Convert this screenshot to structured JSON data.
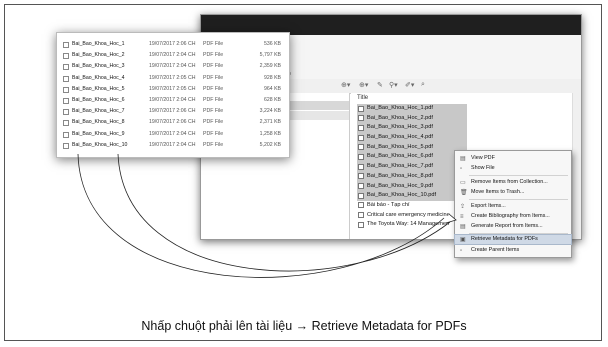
{
  "zotero": {
    "toolbar_hint": "ip",
    "column_title": "Title",
    "items": [
      {
        "title": "Bai_Bao_Khoa_Hoc_1.pdf",
        "selected": true
      },
      {
        "title": "Bai_Bao_Khoa_Hoc_2.pdf",
        "selected": true
      },
      {
        "title": "Bai_Bao_Khoa_Hoc_3.pdf",
        "selected": true
      },
      {
        "title": "Bai_Bao_Khoa_Hoc_4.pdf",
        "selected": true
      },
      {
        "title": "Bai_Bao_Khoa_Hoc_5.pdf",
        "selected": true
      },
      {
        "title": "Bai_Bao_Khoa_Hoc_6.pdf",
        "selected": true
      },
      {
        "title": "Bai_Bao_Khoa_Hoc_7.pdf",
        "selected": true
      },
      {
        "title": "Bai_Bao_Khoa_Hoc_8.pdf",
        "selected": true
      },
      {
        "title": "Bai_Bao_Khoa_Hoc_9.pdf",
        "selected": true
      },
      {
        "title": "Bai_Bao_Khoa_Hoc_10.pdf",
        "selected": true
      },
      {
        "title": "Bài báo - Tạp chí",
        "selected": false
      },
      {
        "title": "Critical care emergency medicine",
        "selected": false
      },
      {
        "title": "The Toyota Way: 14 Managemen",
        "selected": false
      }
    ]
  },
  "explorer": {
    "files": [
      {
        "name": "Bai_Bao_Khoa_Hoc_1",
        "date": "19/07/2017 2:06 CH",
        "type": "PDF File",
        "size": "536 KB"
      },
      {
        "name": "Bai_Bao_Khoa_Hoc_2",
        "date": "19/07/2017 2:04 CH",
        "type": "PDF File",
        "size": "5,797 KB"
      },
      {
        "name": "Bai_Bao_Khoa_Hoc_3",
        "date": "19/07/2017 2:04 CH",
        "type": "PDF File",
        "size": "2,359 KB"
      },
      {
        "name": "Bai_Bao_Khoa_Hoc_4",
        "date": "19/07/2017 2:05 CH",
        "type": "PDF File",
        "size": "928 KB"
      },
      {
        "name": "Bai_Bao_Khoa_Hoc_5",
        "date": "19/07/2017 2:05 CH",
        "type": "PDF File",
        "size": "964 KB"
      },
      {
        "name": "Bai_Bao_Khoa_Hoc_6",
        "date": "19/07/2017 2:04 CH",
        "type": "PDF File",
        "size": "628 KB"
      },
      {
        "name": "Bai_Bao_Khoa_Hoc_7",
        "date": "19/07/2017 2:06 CH",
        "type": "PDF File",
        "size": "3,224 KB"
      },
      {
        "name": "Bai_Bao_Khoa_Hoc_8",
        "date": "19/07/2017 2:06 CH",
        "type": "PDF File",
        "size": "2,371 KB"
      },
      {
        "name": "Bai_Bao_Khoa_Hoc_9",
        "date": "19/07/2017 2:04 CH",
        "type": "PDF File",
        "size": "1,258 KB"
      },
      {
        "name": "Bai_Bao_Khoa_Hoc_10",
        "date": "19/07/2017 2:04 CH",
        "type": "PDF File",
        "size": "5,202 KB"
      }
    ]
  },
  "context_menu": {
    "view_pdf": "View PDF",
    "show_file": "Show File",
    "remove_items": "Remove Items from Collection...",
    "move_trash": "Move Items to Trash...",
    "export_items": "Export Items...",
    "create_bib": "Create Bibliography from Items...",
    "generate_report": "Generate Report from Items...",
    "retrieve_metadata": "Retrieve Metadata for PDFs",
    "create_parent": "Create Parent Items"
  },
  "caption": "Nhấp chuột phải lên tài liệu → Retrieve Metadata for PDFs",
  "colors": {
    "selection": "#c8c8c8",
    "menu_highlight": "#cfd9e6"
  }
}
